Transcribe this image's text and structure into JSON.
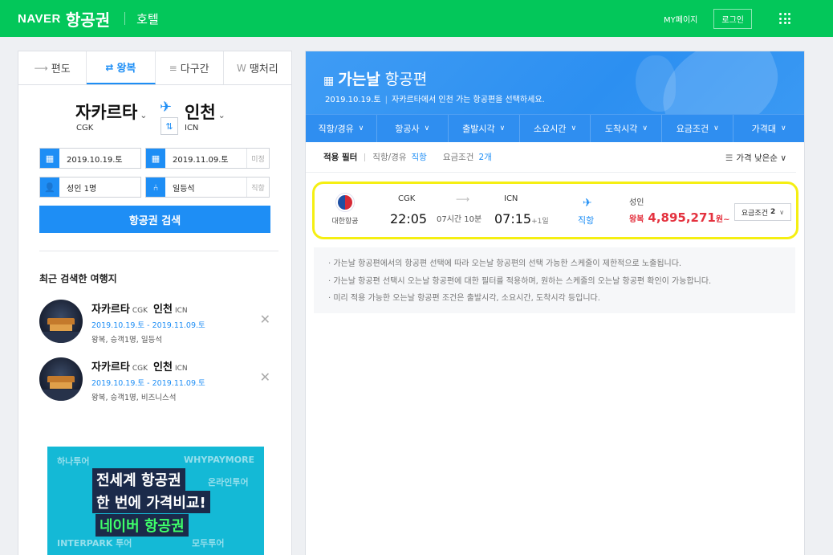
{
  "header": {
    "brand": "NAVER",
    "service": "항공권",
    "hotel": "호텔",
    "my_page": "MY페이지",
    "login": "로그인"
  },
  "search": {
    "tabs": [
      {
        "icon": "⟶",
        "label": "편도"
      },
      {
        "icon": "⇄",
        "label": "왕복"
      },
      {
        "icon": "≡",
        "label": "다구간"
      },
      {
        "icon": "W",
        "label": "땡처리"
      }
    ],
    "from_city": "자카르타",
    "from_code": "CGK",
    "to_city": "인천",
    "to_code": "ICN",
    "depart_date": "2019.10.19.토",
    "return_date": "2019.11.09.토",
    "return_undecided": "미정",
    "passengers": "성인 1명",
    "seat_class": "일등석",
    "direct_only": "직항",
    "search_button": "항공권 검색"
  },
  "recent": {
    "title": "최근 검색한 여행지",
    "items": [
      {
        "from": "자카르타",
        "from_code": "CGK",
        "to": "인천",
        "to_code": "ICN",
        "dates": "2019.10.19.토 - 2019.11.09.토",
        "detail": "왕복, 승객1명, 일등석"
      },
      {
        "from": "자카르타",
        "from_code": "CGK",
        "to": "인천",
        "to_code": "ICN",
        "dates": "2019.10.19.토 - 2019.11.09.토",
        "detail": "왕복, 승객1명, 비즈니스석"
      }
    ]
  },
  "banner": {
    "line1": "전세계 항공권",
    "line2": "한 번에 가격비교!",
    "line3": "네이버 항공권",
    "bg_1": "하나투어",
    "bg_2": "WHYPAYMORE",
    "bg_3": "온라인투어",
    "bg_4": "INTERPARK 투어",
    "bg_5": "모두투어"
  },
  "results": {
    "title_bold": "가는날",
    "title_rest": "항공편",
    "sub_date": "2019.10.19.토",
    "sub_text": "자카르타에서 인천 가는 항공편을 선택하세요.",
    "filters": [
      "직항/경유",
      "항공사",
      "출발시각",
      "소요시간",
      "도착시각",
      "요금조건",
      "가격대"
    ],
    "applied_label": "적용 필터",
    "applied_k1": "직항/경유",
    "applied_v1": "직항",
    "applied_k2": "요금조건",
    "applied_v2": "2개",
    "sort": "가격 낮은순"
  },
  "flight": {
    "airline": "대한항공",
    "dep_code": "CGK",
    "dep_time": "22:05",
    "duration": "07시간 10분",
    "arr_code": "ICN",
    "arr_time": "07:15",
    "arr_plus": "+1일",
    "direct": "직항",
    "pax": "성인",
    "price_type": "왕복",
    "price": "4,895,271",
    "price_unit": "원~",
    "condition_label": "요금조건",
    "condition_count": "2"
  },
  "notices": [
    "· 가는날 항공편에서의 항공편 선택에 따라 오는날 항공편의 선택 가능한 스케줄이 제한적으로 노출됩니다.",
    "· 가는날 항공편 선택시 오는날 항공편에 대한 필터를 적용하며, 원하는 스케줄의 오는날 항공편 확인이 가능합니다.",
    "· 미리 적용 가능한 오는날 항공편 조건은 출발시각, 소요시간, 도착시각 등입니다."
  ],
  "colors": {
    "header_green": "#03c75a",
    "accent_blue": "#1e8ef5",
    "price_red": "#e4323f",
    "highlight_yellow": "#f5ef12"
  }
}
